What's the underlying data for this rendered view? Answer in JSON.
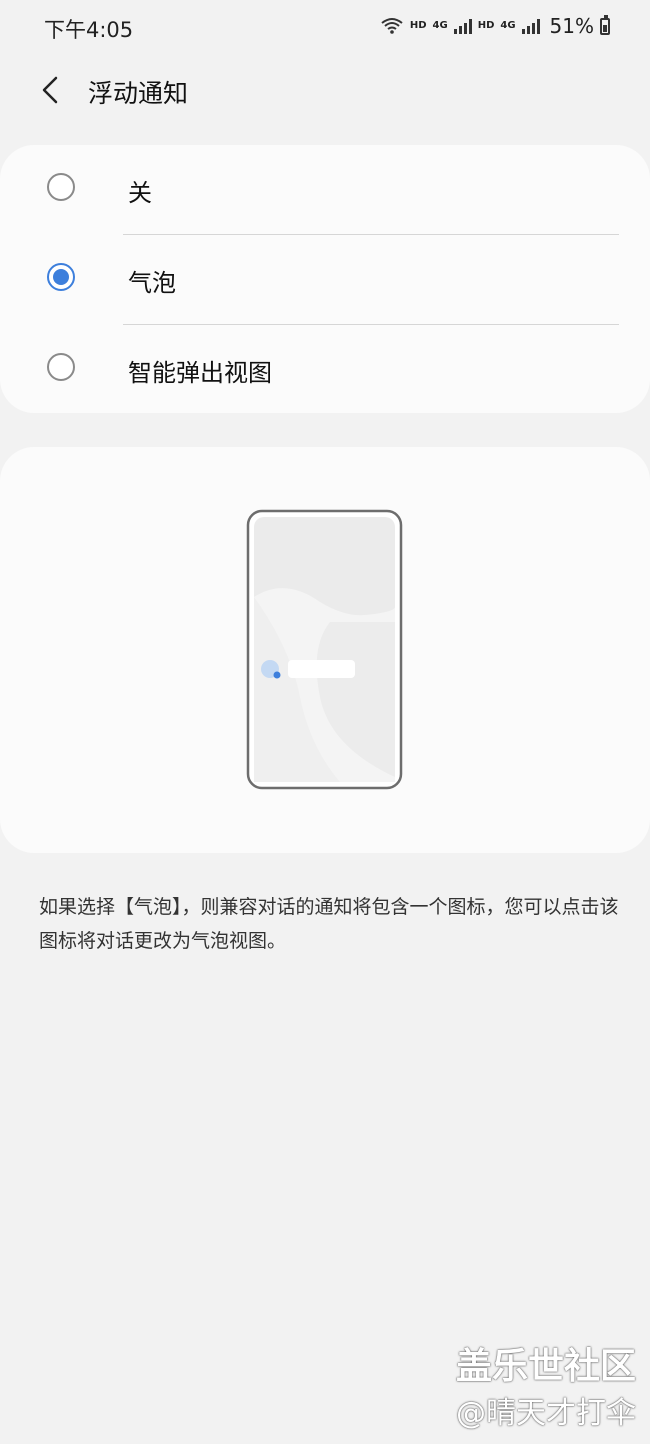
{
  "status_bar": {
    "time": "下午4:05",
    "hd1": "HD",
    "net1": "4G",
    "hd2": "HD",
    "net2": "4G",
    "battery": "51%"
  },
  "header": {
    "title": "浮动通知"
  },
  "options": [
    {
      "label": "关",
      "selected": false
    },
    {
      "label": "气泡",
      "selected": true
    },
    {
      "label": "智能弹出视图",
      "selected": false
    }
  ],
  "description": "如果选择【气泡】，则兼容对话的通知将包含一个图标，您可以点击该图标将对话更改为气泡视图。",
  "watermark": {
    "line1": "盖乐世社区",
    "line2": "@晴天才打伞"
  },
  "colors": {
    "accent": "#3d7fdc",
    "background": "#f2f2f2",
    "card": "#fbfbfb"
  }
}
